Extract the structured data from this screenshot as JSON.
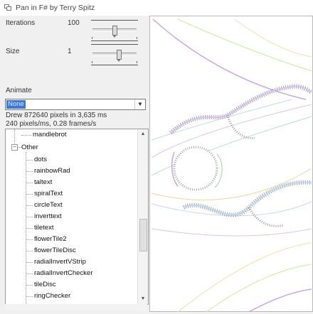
{
  "window": {
    "title": "Pan in F# by Terry Spitz"
  },
  "controls": {
    "iterations_label": "Iterations",
    "iterations_value": "100",
    "size_label": "Size",
    "size_value": "1",
    "animate_label": "Animate",
    "animate_selected": "None"
  },
  "status": {
    "line1": "Drew 872640 pixels in 3,635 ms",
    "line2": "240 pixels/ms, 0.28 frames/s"
  },
  "tree": {
    "top_item": "mandlebrot",
    "group": "Other",
    "items": [
      "dots",
      "rainbowRad",
      "taltext",
      "spiralText",
      "circleText",
      "inverttext",
      "tiletext",
      "flowerTile2",
      "flowerTileDisc",
      "radialInvertVStrip",
      "radialInvertChecker",
      "tileDisc",
      "ringChecker"
    ]
  },
  "colors": {
    "selection": "#3d78d8"
  }
}
